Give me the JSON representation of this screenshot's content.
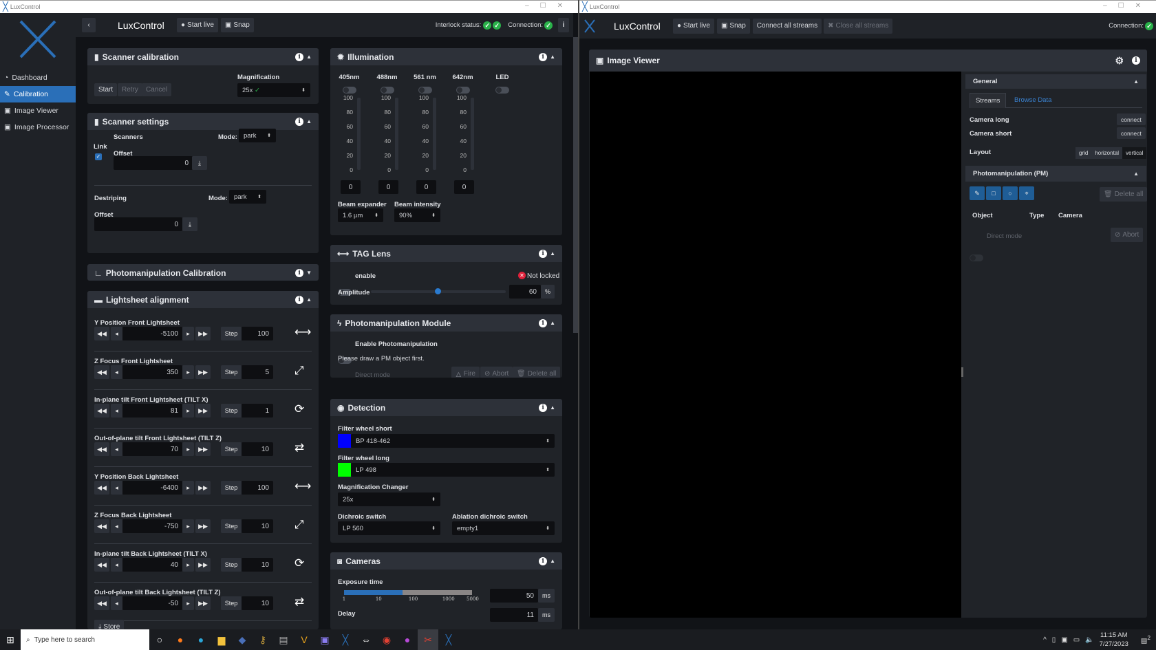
{
  "left_window": {
    "title": "LuxControl",
    "app_title": "LuxControl",
    "start_live": "Start live",
    "snap": "Snap",
    "interlock_label": "Interlock status:",
    "connection_label": "Connection:",
    "sidebar": [
      {
        "label": "Dashboard",
        "icon": "dashboard-icon"
      },
      {
        "label": "Calibration",
        "icon": "wrench-icon",
        "active": true
      },
      {
        "label": "Image Viewer",
        "icon": "image-icon"
      },
      {
        "label": "Image Processor",
        "icon": "images-icon"
      }
    ],
    "scanner_calibration": {
      "title": "Scanner calibration",
      "start": "Start",
      "retry": "Retry",
      "cancel": "Cancel",
      "magnification_label": "Magnification",
      "magnification": "25x"
    },
    "scanner_settings": {
      "title": "Scanner settings",
      "scanners": "Scanners",
      "mode_label": "Mode:",
      "scanners_mode": "park",
      "link": "Link",
      "link_checked": true,
      "offset_label": "Offset",
      "scanners_offset": "0",
      "destriping": "Destriping",
      "destriping_mode": "park",
      "destriping_offset": "0"
    },
    "pm_calibration": {
      "title": "Photomanipulation Calibration"
    },
    "lightsheet": {
      "title": "Lightsheet alignment",
      "step_label": "Step",
      "store_label": "Store",
      "rows": [
        {
          "label": "Y Position Front Lightsheet",
          "value": "-5100",
          "step": "100",
          "icon": "arrows-horizontal-icon"
        },
        {
          "label": "Z Focus Front Lightsheet",
          "value": "350",
          "step": "5",
          "icon": "arrows-diagonal-icon"
        },
        {
          "label": "In-plane tilt Front Lightsheet (TILT X)",
          "value": "81",
          "step": "1",
          "icon": "sync-icon"
        },
        {
          "label": "Out-of-plane tilt Front Lightsheet (TILT Z)",
          "value": "70",
          "step": "10",
          "icon": "exchange-icon"
        },
        {
          "label": "Y Position Back Lightsheet",
          "value": "-6400",
          "step": "100",
          "icon": "arrows-horizontal-icon"
        },
        {
          "label": "Z Focus Back Lightsheet",
          "value": "-750",
          "step": "10",
          "icon": "arrows-diagonal-icon"
        },
        {
          "label": "In-plane tilt Back Lightsheet (TILT X)",
          "value": "40",
          "step": "10",
          "icon": "sync-icon"
        },
        {
          "label": "Out-of-plane tilt Back Lightsheet (TILT Z)",
          "value": "-50",
          "step": "10",
          "icon": "exchange-icon"
        }
      ]
    },
    "illumination": {
      "title": "Illumination",
      "channels": [
        {
          "label": "405nm",
          "value": "0"
        },
        {
          "label": "488nm",
          "value": "0"
        },
        {
          "label": "561 nm",
          "value": "0"
        },
        {
          "label": "642nm",
          "value": "0"
        }
      ],
      "led_label": "LED",
      "ticks": [
        "100",
        "80",
        "60",
        "40",
        "20",
        "0"
      ],
      "beam_expander_label": "Beam expander",
      "beam_expander": "1.6 µm",
      "beam_intensity_label": "Beam intensity",
      "beam_intensity": "90%"
    },
    "tag_lens": {
      "title": "TAG Lens",
      "enable": "enable",
      "status": "Not locked",
      "amplitude_label": "Amplitude",
      "amplitude": "60",
      "unit": "%"
    },
    "pm_module": {
      "title": "Photomanipulation Module",
      "enable": "Enable Photomanipulation",
      "hint": "Please draw a PM object first.",
      "direct_mode": "Direct mode",
      "fire": "Fire",
      "abort": "Abort",
      "delete_all": "Delete all"
    },
    "detection": {
      "title": "Detection",
      "fw_short_label": "Filter wheel short",
      "fw_short": "BP 418-462",
      "fw_short_color": "#0000ff",
      "fw_long_label": "Filter wheel long",
      "fw_long": "LP 498",
      "fw_long_color": "#00ff00",
      "mag_changer_label": "Magnification Changer",
      "mag_changer": "25x",
      "dichroic_label": "Dichroic switch",
      "dichroic": "LP 560",
      "ablation_label": "Ablation dichroic switch",
      "ablation": "empty1"
    },
    "cameras": {
      "title": "Cameras",
      "exposure_label": "Exposure time",
      "exposure": "50",
      "exposure_ticks": [
        "1",
        "10",
        "100",
        "1000",
        "5000"
      ],
      "ms": "ms",
      "delay_label": "Delay",
      "delay": "11"
    }
  },
  "right_window": {
    "title": "LuxControl",
    "app_title": "LuxControl",
    "start_live": "Start live",
    "snap": "Snap",
    "connect_all": "Connect all streams",
    "close_all": "Close all streams",
    "connection_label": "Connection:",
    "viewer_title": "Image Viewer",
    "general": {
      "title": "General",
      "tabs": [
        "Streams",
        "Browse Data"
      ],
      "camera_long": "Camera long",
      "camera_short": "Camera short",
      "connect": "connect",
      "layout_label": "Layout",
      "layouts": [
        "grid",
        "horizontal",
        "vertical"
      ],
      "layout_selected": "vertical"
    },
    "pm": {
      "title": "Photomanipulation (PM)",
      "delete_all": "Delete all",
      "columns": [
        "Object",
        "Type",
        "Camera"
      ],
      "direct_mode": "Direct mode",
      "abort": "Abort"
    }
  },
  "taskbar": {
    "search_placeholder": "Type here to search",
    "time": "11:15 AM",
    "date": "7/27/2023",
    "notifications": "2"
  }
}
